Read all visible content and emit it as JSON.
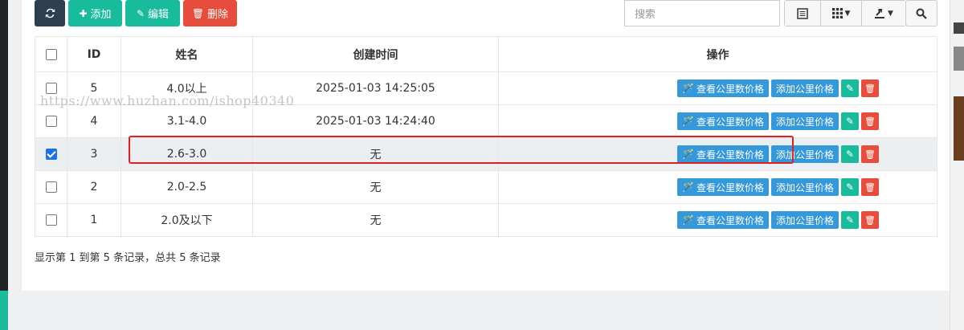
{
  "toolbar": {
    "add_label": "添加",
    "edit_label": "编辑",
    "delete_label": "删除"
  },
  "search": {
    "placeholder": "搜索"
  },
  "table": {
    "headers": [
      "ID",
      "姓名",
      "创建时间",
      "操作"
    ],
    "rows": [
      {
        "id": "5",
        "name": "4.0以上",
        "created": "2025-01-03 14:25:05",
        "checked": false
      },
      {
        "id": "4",
        "name": "3.1-4.0",
        "created": "2025-01-03 14:24:40",
        "checked": false
      },
      {
        "id": "3",
        "name": "2.6-3.0",
        "created": "无",
        "checked": true
      },
      {
        "id": "2",
        "name": "2.0-2.5",
        "created": "无",
        "checked": false
      },
      {
        "id": "1",
        "name": "2.0及以下",
        "created": "无",
        "checked": false
      }
    ],
    "op_view_label": "查看公里数价格",
    "op_add_label": "添加公里价格"
  },
  "summary": "显示第 1 到第 5 条记录，总共 5 条记录",
  "watermark": "https://www.huzhan.com/ishop40340",
  "colors": {
    "primary_green": "#18bc9c",
    "danger": "#e74c3c",
    "info": "#3498db",
    "dark": "#2c3e50"
  }
}
